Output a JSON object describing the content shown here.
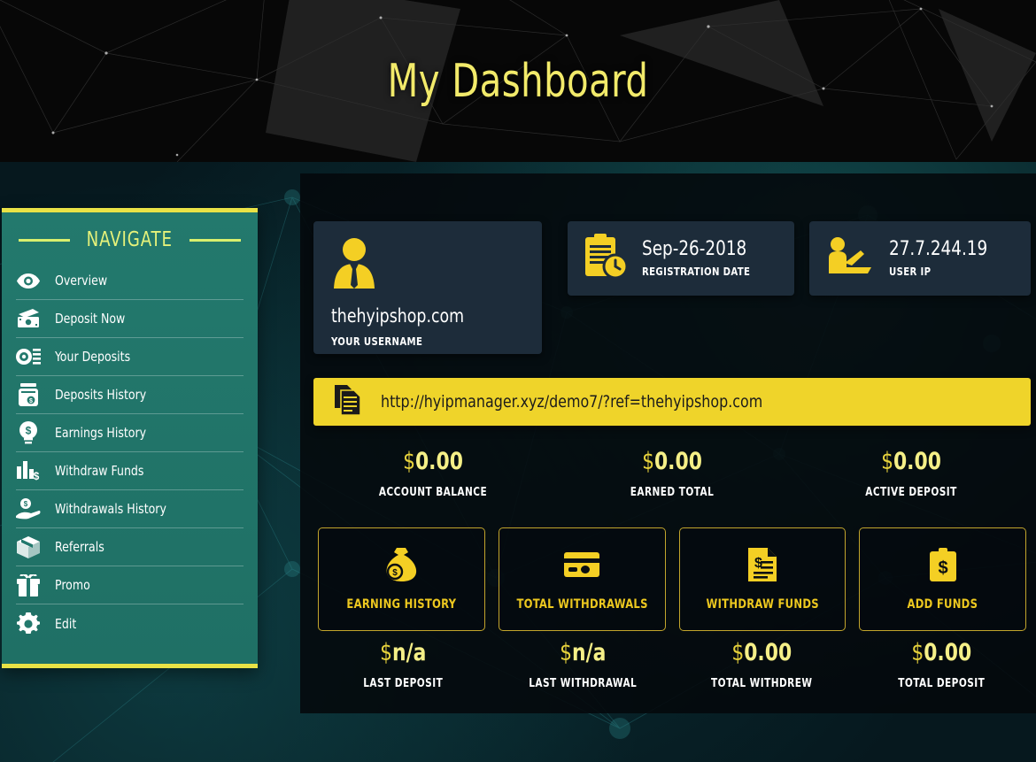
{
  "header": {
    "title": "My Dashboard"
  },
  "sidebar": {
    "heading": "NAVIGATE",
    "items": [
      {
        "label": "Overview",
        "icon": "eye-icon"
      },
      {
        "label": "Deposit Now",
        "icon": "banknotes-icon"
      },
      {
        "label": "Your Deposits",
        "icon": "coin-list-icon"
      },
      {
        "label": "Deposits History",
        "icon": "money-jar-icon"
      },
      {
        "label": "Earnings History",
        "icon": "lightbulb-dollar-icon"
      },
      {
        "label": "Withdraw Funds",
        "icon": "bar-chart-dollar-icon"
      },
      {
        "label": "Withdrawals History",
        "icon": "hand-coin-icon"
      },
      {
        "label": "Referrals",
        "icon": "box-icon"
      },
      {
        "label": "Promo",
        "icon": "gift-icon"
      },
      {
        "label": "Edit",
        "icon": "gear-icon"
      }
    ]
  },
  "cards": {
    "user": {
      "value": "thehyipshop.com",
      "label": "YOUR USERNAME",
      "icon": "user-tie-icon"
    },
    "register": {
      "value": "Sep-26-2018",
      "label": "REGISTRATION DATE",
      "icon": "clipboard-clock-icon"
    },
    "userip": {
      "value": "27.7.244.19",
      "label": "USER IP",
      "icon": "person-laptop-icon"
    }
  },
  "reflink": {
    "url": "http://hyipmanager.xyz/demo7/?ref=thehyipshop.com",
    "icon": "copy-document-icon"
  },
  "stats_top": [
    {
      "currency": "$",
      "amount": "0.00",
      "label": "ACCOUNT BALANCE"
    },
    {
      "currency": "$",
      "amount": "0.00",
      "label": "EARNED TOTAL"
    },
    {
      "currency": "$",
      "amount": "0.00",
      "label": "ACTIVE DEPOSIT"
    }
  ],
  "tiles": [
    {
      "label": "EARNING HISTORY",
      "icon": "money-bag-icon"
    },
    {
      "label": "TOTAL WITHDRAWALS",
      "icon": "credit-card-icon"
    },
    {
      "label": "WITHDRAW FUNDS",
      "icon": "invoice-dollar-icon"
    },
    {
      "label": "ADD FUNDS",
      "icon": "clipboard-dollar-icon"
    }
  ],
  "stats_bottom": [
    {
      "currency": "$",
      "amount": "n/a",
      "label": "LAST DEPOSIT"
    },
    {
      "currency": "$",
      "amount": "n/a",
      "label": "LAST WITHDRAWAL"
    },
    {
      "currency": "$",
      "amount": "0.00",
      "label": "TOTAL WITHDREW"
    },
    {
      "currency": "$",
      "amount": "0.00",
      "label": "TOTAL DEPOSIT"
    }
  ],
  "colors": {
    "accent_yellow": "#efd42a",
    "accent_gold": "#f4cf24",
    "sidebar_teal": "#23796d",
    "card_navy": "#1d2c3a",
    "title_yellow": "#f2ea6a"
  }
}
